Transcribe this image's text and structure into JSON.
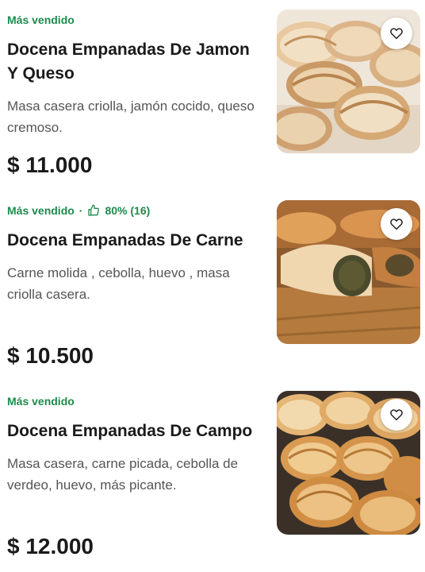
{
  "products": [
    {
      "badge": "Más vendido",
      "rating": null,
      "title": "Docena Empanadas De Jamon Y Queso",
      "description": "Masa casera criolla, jamón cocido, queso cremoso.",
      "price": "$ 11.000",
      "image_icon": "empanadas-photo",
      "favorite_icon": "heart-icon"
    },
    {
      "badge": "Más vendido",
      "separator": "·",
      "rating": "80% (16)",
      "rating_icon": "thumbs-up-icon",
      "title": "Docena Empanadas De Carne",
      "description": "Carne molida , cebolla, huevo , masa criolla casera.",
      "price": "$ 10.500",
      "image_icon": "empanadas-photo",
      "favorite_icon": "heart-icon"
    },
    {
      "badge": "Más vendido",
      "rating": null,
      "title": "Docena Empanadas De Campo",
      "description": "Masa casera, carne picada, cebolla de verdeo, huevo, más picante.",
      "price": "$ 12.000",
      "image_icon": "empanadas-photo",
      "favorite_icon": "heart-icon"
    }
  ],
  "colors": {
    "badge_green": "#1f8a4c",
    "title_text": "#1a1a1a",
    "description_text": "#555555",
    "background": "#ffffff"
  }
}
